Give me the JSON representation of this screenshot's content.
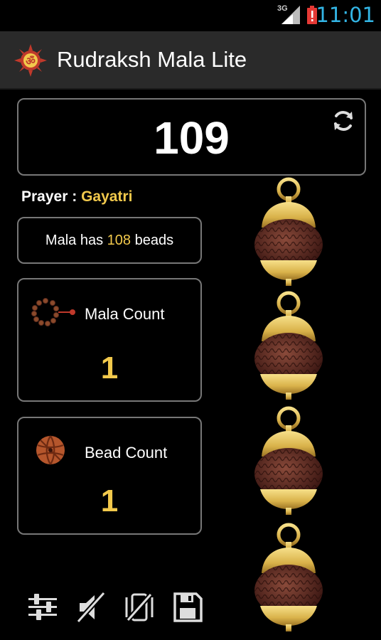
{
  "status_bar": {
    "network": "3G",
    "time": "11:01",
    "colors": {
      "time": "#33b5e5",
      "alert": "#e53935"
    }
  },
  "app": {
    "title": "Rudraksh Mala Lite",
    "icon": "om-logo-icon"
  },
  "counter": {
    "value": "109",
    "reset_icon": "refresh-icon"
  },
  "prayer": {
    "label": "Prayer : ",
    "name": "Gayatri"
  },
  "mala_info": {
    "prefix": "Mala has ",
    "beads": "108",
    "suffix": " beads"
  },
  "mala_count": {
    "label": "Mala Count",
    "value": "1",
    "icon": "mala-string-icon"
  },
  "bead_count": {
    "label": "Bead Count",
    "value": "1",
    "icon": "rudraksha-bead-icon"
  },
  "toolbar": {
    "items": [
      "settings-sliders-icon",
      "sound-off-icon",
      "vibrate-off-icon",
      "save-icon"
    ]
  },
  "colors": {
    "accent": "#f2c94c",
    "border": "#777777",
    "action_bar": "#2a2a2a",
    "bead": "#5a2a1c",
    "gold": "#d9b24a"
  }
}
